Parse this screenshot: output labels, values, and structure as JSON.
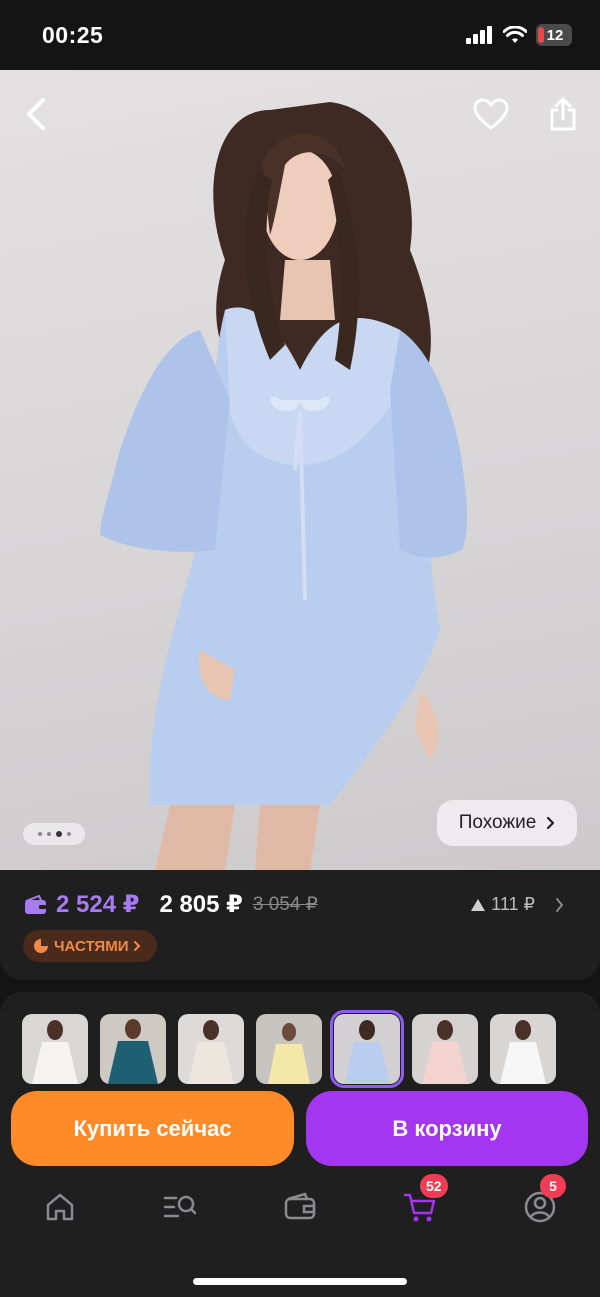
{
  "status_bar": {
    "time": "00:25",
    "battery": "12"
  },
  "product": {
    "wallet_price": "2 524 ₽",
    "price": "2 805 ₽",
    "old_price": "3 054 ₽",
    "price_change": "111 ₽",
    "installments_label": "ЧАСТЯМИ",
    "similar_label": "Похожие",
    "gallery_dots": 4,
    "gallery_active_index": 2
  },
  "actions": {
    "buy_now": "Купить сейчас",
    "add_to_cart": "В корзину"
  },
  "tabbar": {
    "cart_badge": "52",
    "profile_badge": "5"
  },
  "icons": [
    "back-icon",
    "heart-icon",
    "share-icon",
    "wallet-icon",
    "arrow-up-icon",
    "chevron-right-icon",
    "home-icon",
    "catalog-search-icon",
    "wallet-tab-icon",
    "cart-icon",
    "profile-icon"
  ],
  "colors": {
    "accent_purple": "#a435f0",
    "accent_orange": "#ff8a28",
    "wallet_price": "#a77bf3",
    "badge_red": "#f03c55"
  }
}
